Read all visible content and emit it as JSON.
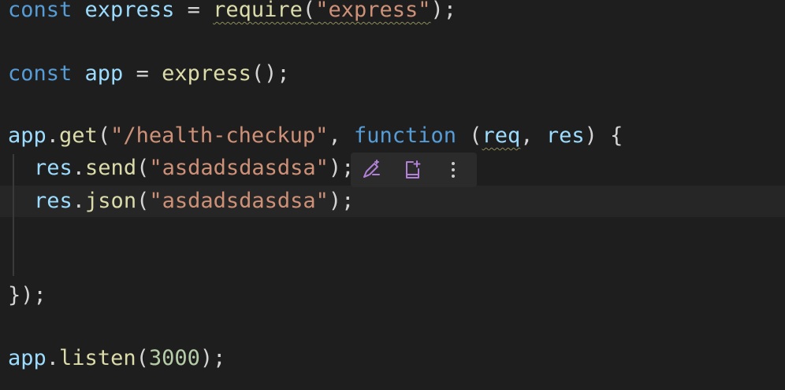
{
  "code": {
    "line1": {
      "kw": "const",
      "name": "express",
      "op": " = ",
      "fn": "require",
      "open": "(",
      "str": "\"express\"",
      "close": ");"
    },
    "line3": {
      "kw": "const",
      "name": "app",
      "op": " = ",
      "fn": "express",
      "tail": "();"
    },
    "line5": {
      "obj": "app",
      "dot": ".",
      "fn": "get",
      "open": "(",
      "str": "\"/health-checkup\"",
      "comma": ", ",
      "kw": "function",
      "sp": " (",
      "p1": "req",
      "comma2": ", ",
      "p2": "res",
      "tail": ") {"
    },
    "line6": {
      "obj": "res",
      "dot": ".",
      "fn": "send",
      "open": "(",
      "str": "\"asdadsdasdsa\"",
      "tail": ");"
    },
    "line7": {
      "obj": "res",
      "dot": ".",
      "fn": "json",
      "open": "(",
      "str": "\"asdadsdasdsa\"",
      "tail": ");"
    },
    "line10": {
      "text": "});"
    },
    "line12": {
      "obj": "app",
      "dot": ".",
      "fn": "listen",
      "open": "(",
      "num": "3000",
      "tail": ");"
    }
  },
  "inline_toolbar": {
    "buttons": [
      {
        "icon": "edit-sparkle-icon"
      },
      {
        "icon": "add-note-icon"
      },
      {
        "icon": "more-vertical-icon"
      }
    ],
    "icon_color": "#b180d7"
  }
}
